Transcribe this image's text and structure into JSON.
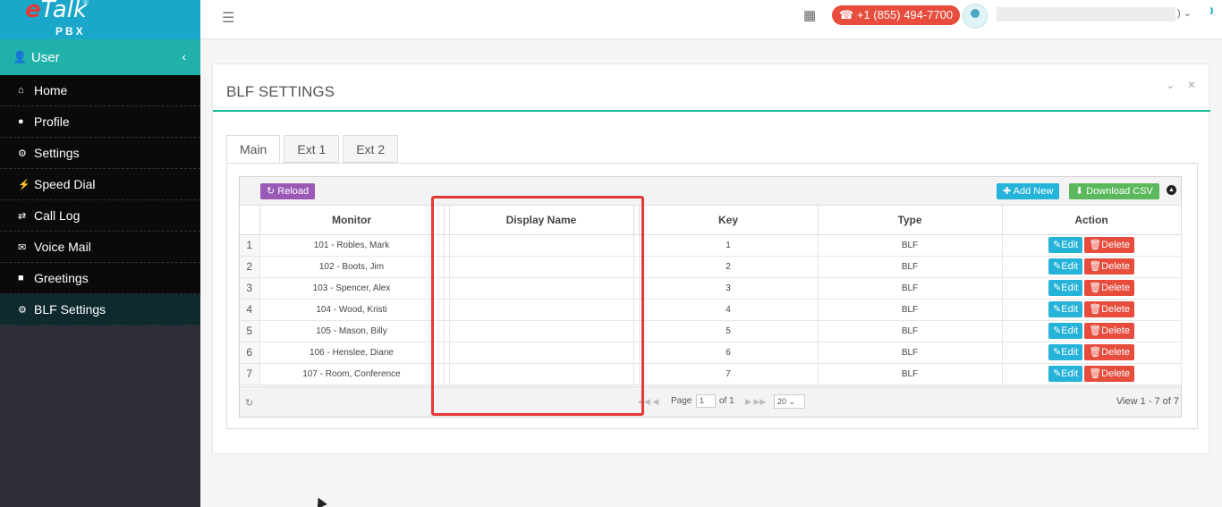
{
  "logo": {
    "brand_prefix": "e",
    "brand_main": "Talk",
    "reg": "®",
    "sub": "PBX"
  },
  "user_section": {
    "label": "User",
    "icon": "user-icon"
  },
  "nav": [
    {
      "label": "Home",
      "icon": "home-icon"
    },
    {
      "label": "Profile",
      "icon": "user-icon"
    },
    {
      "label": "Settings",
      "icon": "gear-icon"
    },
    {
      "label": "Speed Dial",
      "icon": "bolt-icon"
    },
    {
      "label": "Call Log",
      "icon": "exchange-icon"
    },
    {
      "label": "Voice Mail",
      "icon": "bullhorn-icon"
    },
    {
      "label": "Greetings",
      "icon": "gift-icon"
    },
    {
      "label": "BLF Settings",
      "icon": "gear-icon",
      "active": true
    }
  ],
  "topbar": {
    "phone": "+1 (855) 494-7700",
    "name_suffix": ")"
  },
  "panel": {
    "title": "BLF SETTINGS"
  },
  "tabs": [
    "Main",
    "Ext 1",
    "Ext 2"
  ],
  "toolbar": {
    "reload": "Reload",
    "add_new": "Add New",
    "download_csv": "Download CSV"
  },
  "table": {
    "headers": {
      "monitor": "Monitor",
      "display_name": "Display Name",
      "key": "Key",
      "type": "Type",
      "action": "Action"
    },
    "rows": [
      {
        "n": "1",
        "monitor": "101 - Robles, Mark",
        "display_name": "",
        "key": "1",
        "type": "BLF"
      },
      {
        "n": "2",
        "monitor": "102 - Boots, Jim",
        "display_name": "",
        "key": "2",
        "type": "BLF"
      },
      {
        "n": "3",
        "monitor": "103 - Spencer, Alex",
        "display_name": "",
        "key": "3",
        "type": "BLF"
      },
      {
        "n": "4",
        "monitor": "104 - Wood, Kristi",
        "display_name": "",
        "key": "4",
        "type": "BLF"
      },
      {
        "n": "5",
        "monitor": "105 - Mason, Billy",
        "display_name": "",
        "key": "5",
        "type": "BLF"
      },
      {
        "n": "6",
        "monitor": "106 - Henslee, Diane",
        "display_name": "",
        "key": "6",
        "type": "BLF"
      },
      {
        "n": "7",
        "monitor": "107 - Room, Conference",
        "display_name": "",
        "key": "7",
        "type": "BLF"
      }
    ],
    "edit_label": "Edit",
    "delete_label": "Delete"
  },
  "pager": {
    "page_label": "Page",
    "page_value": "1",
    "of_label": "of 1",
    "page_size": "20",
    "view_text": "View 1 - 7 of 7"
  },
  "colors": {
    "sidebar_top": "#1aa7c9",
    "user_bar": "#20b2aa",
    "accent_line": "#1abb9c",
    "highlight": "#e53935"
  }
}
